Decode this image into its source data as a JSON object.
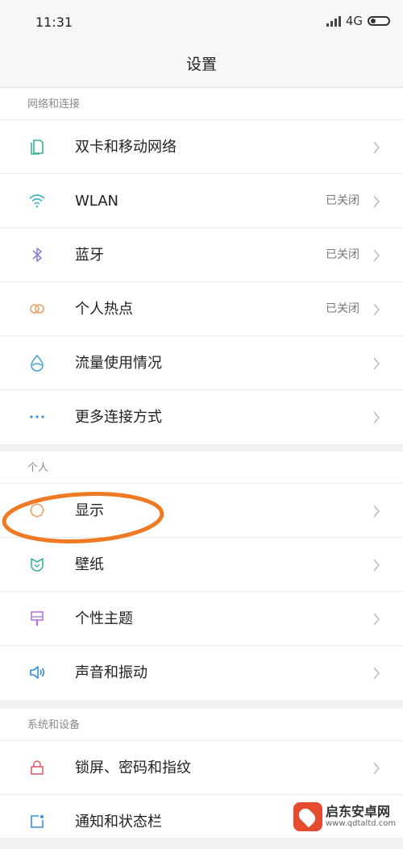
{
  "status": {
    "time": "11:31",
    "network": "4G"
  },
  "header": {
    "title": "设置"
  },
  "sections": [
    {
      "title": "网络和连接",
      "items": [
        {
          "label": "双卡和移动网络",
          "value": "",
          "icon": "sim-card-icon"
        },
        {
          "label": "WLAN",
          "value": "已关闭",
          "icon": "wifi-icon"
        },
        {
          "label": "蓝牙",
          "value": "已关闭",
          "icon": "bluetooth-icon"
        },
        {
          "label": "个人热点",
          "value": "已关闭",
          "icon": "hotspot-icon"
        },
        {
          "label": "流量使用情况",
          "value": "",
          "icon": "data-usage-icon"
        },
        {
          "label": "更多连接方式",
          "value": "",
          "icon": "more-dots-icon"
        }
      ]
    },
    {
      "title": "个人",
      "items": [
        {
          "label": "显示",
          "value": "",
          "icon": "display-sun-icon"
        },
        {
          "label": "壁纸",
          "value": "",
          "icon": "wallpaper-icon"
        },
        {
          "label": "个性主题",
          "value": "",
          "icon": "theme-icon"
        },
        {
          "label": "声音和振动",
          "value": "",
          "icon": "sound-icon"
        }
      ]
    },
    {
      "title": "系统和设备",
      "items": [
        {
          "label": "锁屏、密码和指纹",
          "value": "",
          "icon": "lock-icon"
        },
        {
          "label": "通知和状态栏",
          "value": "",
          "icon": "notification-icon"
        }
      ]
    }
  ],
  "watermark": {
    "title": "启东安卓网",
    "url": "www.qdtaltd.com"
  },
  "colors": {
    "sim": "#39b49c",
    "wifi": "#3fb6c9",
    "bluetooth": "#8e7fd6",
    "hotspot": "#f0a068",
    "data": "#4aa3d8",
    "more": "#3a8fd8",
    "display": "#f0a068",
    "wallpaper": "#38b39a",
    "theme": "#b07bd6",
    "sound": "#2f8fd8",
    "lock": "#e0606a",
    "notify": "#3a8fd8",
    "annotation": "#f07a23"
  }
}
